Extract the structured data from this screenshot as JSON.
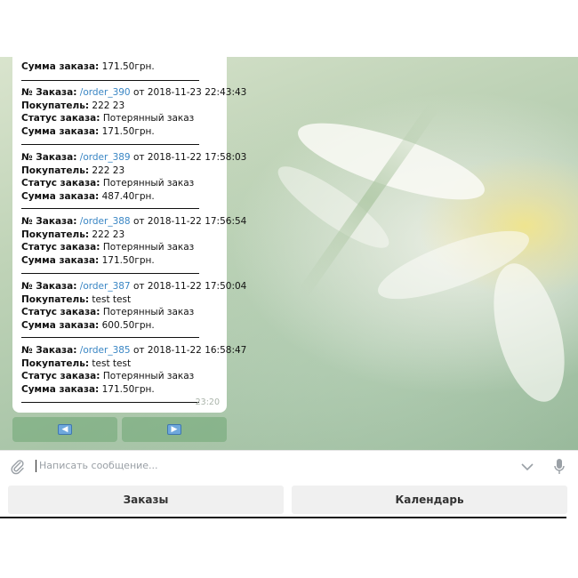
{
  "messages": {
    "partial": {
      "total_label": "Сумма заказа:",
      "total_value": "171.50грн."
    },
    "orders": [
      {
        "no_label": "№ Заказа:",
        "link": "/order_390",
        "datetime": "от 2018-11-23 22:43:43",
        "buyer_label": "Покупатель:",
        "buyer": "222 23",
        "status_label": "Статус заказа:",
        "status": "Потерянный заказ",
        "total_label": "Сумма заказа:",
        "total": "171.50грн."
      },
      {
        "no_label": "№ Заказа:",
        "link": "/order_389",
        "datetime": "от 2018-11-22 17:58:03",
        "buyer_label": "Покупатель:",
        "buyer": "222 23",
        "status_label": "Статус заказа:",
        "status": "Потерянный заказ",
        "total_label": "Сумма заказа:",
        "total": "487.40грн."
      },
      {
        "no_label": "№ Заказа:",
        "link": "/order_388",
        "datetime": "от 2018-11-22 17:56:54",
        "buyer_label": "Покупатель:",
        "buyer": "222 23",
        "status_label": "Статус заказа:",
        "status": "Потерянный заказ",
        "total_label": "Сумма заказа:",
        "total": "171.50грн."
      },
      {
        "no_label": "№ Заказа:",
        "link": "/order_387",
        "datetime": "от 2018-11-22 17:50:04",
        "buyer_label": "Покупатель:",
        "buyer": "test test",
        "status_label": "Статус заказа:",
        "status": "Потерянный заказ",
        "total_label": "Сумма заказа:",
        "total": "600.50грн."
      },
      {
        "no_label": "№ Заказа:",
        "link": "/order_385",
        "datetime": "от 2018-11-22 16:58:47",
        "buyer_label": "Покупатель:",
        "buyer": "test test",
        "status_label": "Статус заказа:",
        "status": "Потерянный заказ",
        "total_label": "Сумма заказа:",
        "total": "171.50грн."
      }
    ],
    "time": "23:20"
  },
  "inline_buttons": {
    "prev_icon": "arrow-left-icon",
    "next_icon": "arrow-right-icon"
  },
  "composer": {
    "placeholder": "Написать сообщение..."
  },
  "keyboard": {
    "orders_label": "Заказы",
    "calendar_label": "Календарь"
  },
  "colors": {
    "link": "#3a86c4",
    "inline_button": "#6ea573",
    "keyboard_button": "#f0f0f0"
  }
}
